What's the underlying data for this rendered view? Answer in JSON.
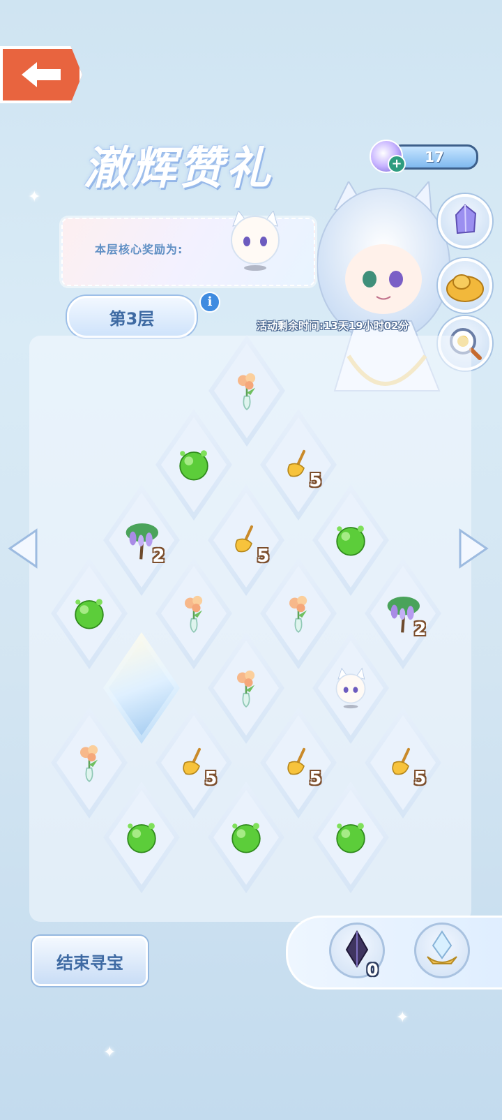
{
  "header": {
    "title": "澈辉赞礼",
    "currency_value": "17"
  },
  "reward": {
    "label": "本层核心奖励为:"
  },
  "floor": {
    "label": "第3层",
    "info_symbol": "i"
  },
  "timer": {
    "text": "活动剩余时间:13天19小时02分"
  },
  "board": {
    "tiles": [
      {
        "item": "flower-vase",
        "count": ""
      },
      {
        "item": "green-orb",
        "count": ""
      },
      {
        "item": "broom",
        "count": "5"
      },
      {
        "item": "wisteria-tree",
        "count": "2"
      },
      {
        "item": "broom",
        "count": "5"
      },
      {
        "item": "green-orb",
        "count": ""
      },
      {
        "item": "green-orb",
        "count": ""
      },
      {
        "item": "flower-vase",
        "count": ""
      },
      {
        "item": "flower-vase",
        "count": ""
      },
      {
        "item": "wisteria-tree",
        "count": "2"
      },
      {
        "item": "crystal-revealed",
        "count": ""
      },
      {
        "item": "flower-vase",
        "count": ""
      },
      {
        "item": "cat-spirit",
        "count": ""
      },
      {
        "item": "flower-vase",
        "count": ""
      },
      {
        "item": "broom",
        "count": "5"
      },
      {
        "item": "broom",
        "count": "5"
      },
      {
        "item": "broom",
        "count": "5"
      },
      {
        "item": "green-orb",
        "count": ""
      },
      {
        "item": "green-orb",
        "count": ""
      },
      {
        "item": "green-orb",
        "count": ""
      }
    ]
  },
  "footer": {
    "end_button": "结束寻宝",
    "slot_dark_crystal_count": "0"
  },
  "colors": {
    "back_button": "#e8643f",
    "accent_blue": "#3e6aa3"
  }
}
